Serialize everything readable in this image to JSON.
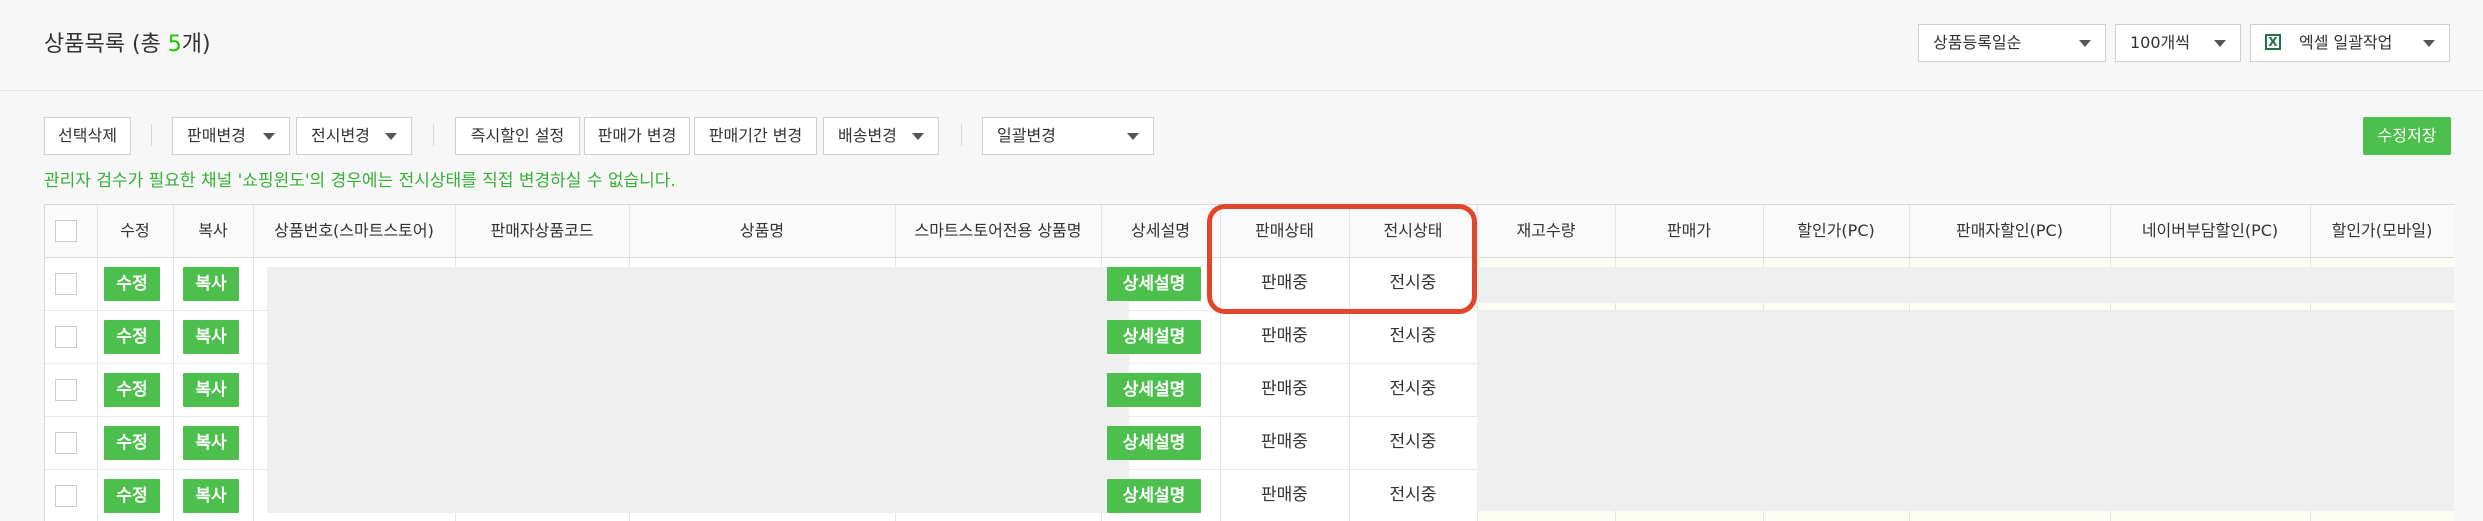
{
  "header": {
    "title_prefix": "상품목록 (총 ",
    "count": "5",
    "title_suffix": "개)",
    "sort_select": "상품등록일순",
    "page_size_select": "100개씩",
    "excel_button": "엑셀 일괄작업",
    "excel_icon_glyph": "X"
  },
  "toolbar": {
    "delete_selected": "선택삭제",
    "sale_change": "판매변경",
    "display_change": "전시변경",
    "instant_discount": "즉시할인 설정",
    "price_change": "판매가 변경",
    "period_change": "판매기간 변경",
    "shipping_change": "배송변경",
    "bulk_change": "일괄변경",
    "save_changes": "수정저장"
  },
  "notice": "관리자 검수가 필요한 채널 '쇼핑윈도'의 경우에는 전시상태를 직접 변경하실 수 없습니다.",
  "table": {
    "headers": [
      "수정",
      "복사",
      "상품번호(스마트스토어)",
      "판매자상품코드",
      "상품명",
      "스마트스토어전용 상품명",
      "상세설명",
      "판매상태",
      "전시상태",
      "재고수량",
      "판매가",
      "할인가(PC)",
      "판매자할인(PC)",
      "네이버부담할인(PC)",
      "할인가(모바일)"
    ],
    "rows": [
      {
        "edit": "수정",
        "copy": "복사",
        "detail": "상세설명",
        "sale_status": "판매중",
        "display_status": "전시중"
      },
      {
        "edit": "수정",
        "copy": "복사",
        "detail": "상세설명",
        "sale_status": "판매중",
        "display_status": "전시중"
      },
      {
        "edit": "수정",
        "copy": "복사",
        "detail": "상세설명",
        "sale_status": "판매중",
        "display_status": "전시중"
      },
      {
        "edit": "수정",
        "copy": "복사",
        "detail": "상세설명",
        "sale_status": "판매중",
        "display_status": "전시중"
      },
      {
        "edit": "수정",
        "copy": "복사",
        "detail": "상세설명",
        "sale_status": "판매중",
        "display_status": "전시중"
      }
    ]
  },
  "colors": {
    "accent_green": "#4cbf4c",
    "notice_green": "#37b037",
    "highlight_red": "#e3452a"
  }
}
